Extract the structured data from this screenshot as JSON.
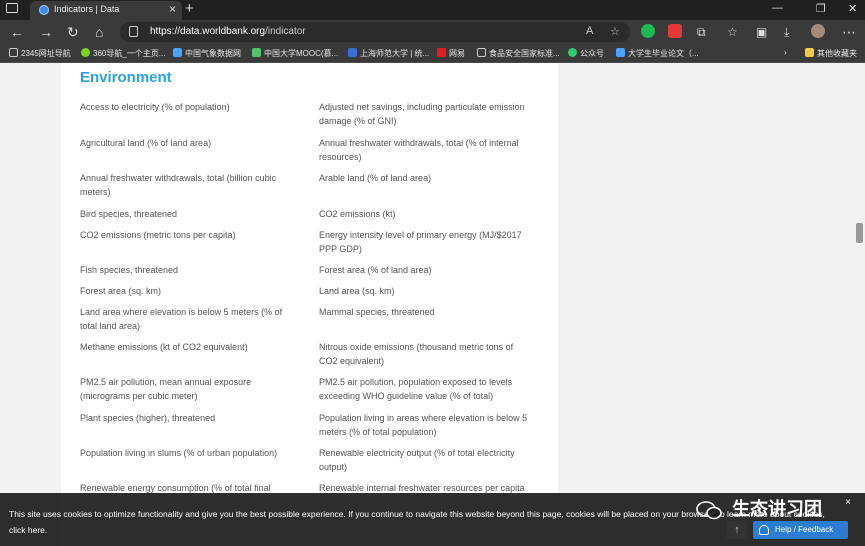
{
  "browser": {
    "tab_title": "Indicators | Data",
    "url_host": "https://data.worldbank.org",
    "url_path": "/indicator",
    "bookmarks": [
      {
        "label": "2345网址导航",
        "color": "#f5a623"
      },
      {
        "label": "360导航_一个主页...",
        "color": "#7ed321"
      },
      {
        "label": "中国气象数据网",
        "color": "#4aa3ff"
      },
      {
        "label": "中国大学MOOC(慕...",
        "color": "#55c26b"
      },
      {
        "label": "上海师范大学 | 统...",
        "color": "#3b6fd8"
      },
      {
        "label": "网易",
        "color": "#e02020"
      },
      {
        "label": "食品安全国家标准...",
        "color": "#cccccc"
      },
      {
        "label": "公众号",
        "color": "#2ecc71"
      },
      {
        "label": "大学生毕业论文（...",
        "color": "#4aa3ff"
      }
    ],
    "other_bookmarks": "其他收藏夹"
  },
  "page": {
    "section_title": "Environment",
    "indicators": [
      "Access to electricity (% of population)",
      "Adjusted net savings, including particulate emission damage (% of GNI)",
      "Agricultural land (% of land area)",
      "Annual freshwater withdrawals, total (% of internal resources)",
      "Annual freshwater withdrawals, total (billion cubic meters)",
      "Arable land (% of land area)",
      "Bird species, threatened",
      "CO2 emissions (kt)",
      "CO2 emissions (metric tons per capita)",
      "Energy intensity level of primary energy (MJ/$2017 PPP GDP)",
      "Fish species, threatened",
      "Forest area (% of land area)",
      "Forest area (sq. km)",
      "Land area (sq. km)",
      "Land area where elevation is below 5 meters (% of total land area)",
      "Mammal species, threatened",
      "Methane emissions (kt of CO2 equivalent)",
      "Nitrous oxide emissions (thousand metric tons of CO2 equivalent)",
      "PM2.5 air pollution, mean annual exposure (micrograms per cubic meter)",
      "PM2.5 air pollution, population exposed to levels exceeding WHO guideline value (% of total)",
      "Plant species (higher), threatened",
      "Population living in areas where elevation is below 5 meters (% of total population)",
      "Population living in slums (% of urban population)",
      "Renewable electricity output (% of total electricity output)",
      "Renewable energy consumption (% of total final",
      "Renewable internal freshwater resources per capita"
    ]
  },
  "cookie_bar": {
    "text": "This site uses cookies to optimize functionality and give you the best possible experience. If you continue to navigate this website beyond this page, cookies will be placed on your browser. To learn more about cookies, click here.",
    "close": "×"
  },
  "watermark": "生态讲习团",
  "help_button": "Help / Feedback",
  "colors": {
    "accent": "#2aa3e6",
    "help": "#2b7cd3"
  }
}
